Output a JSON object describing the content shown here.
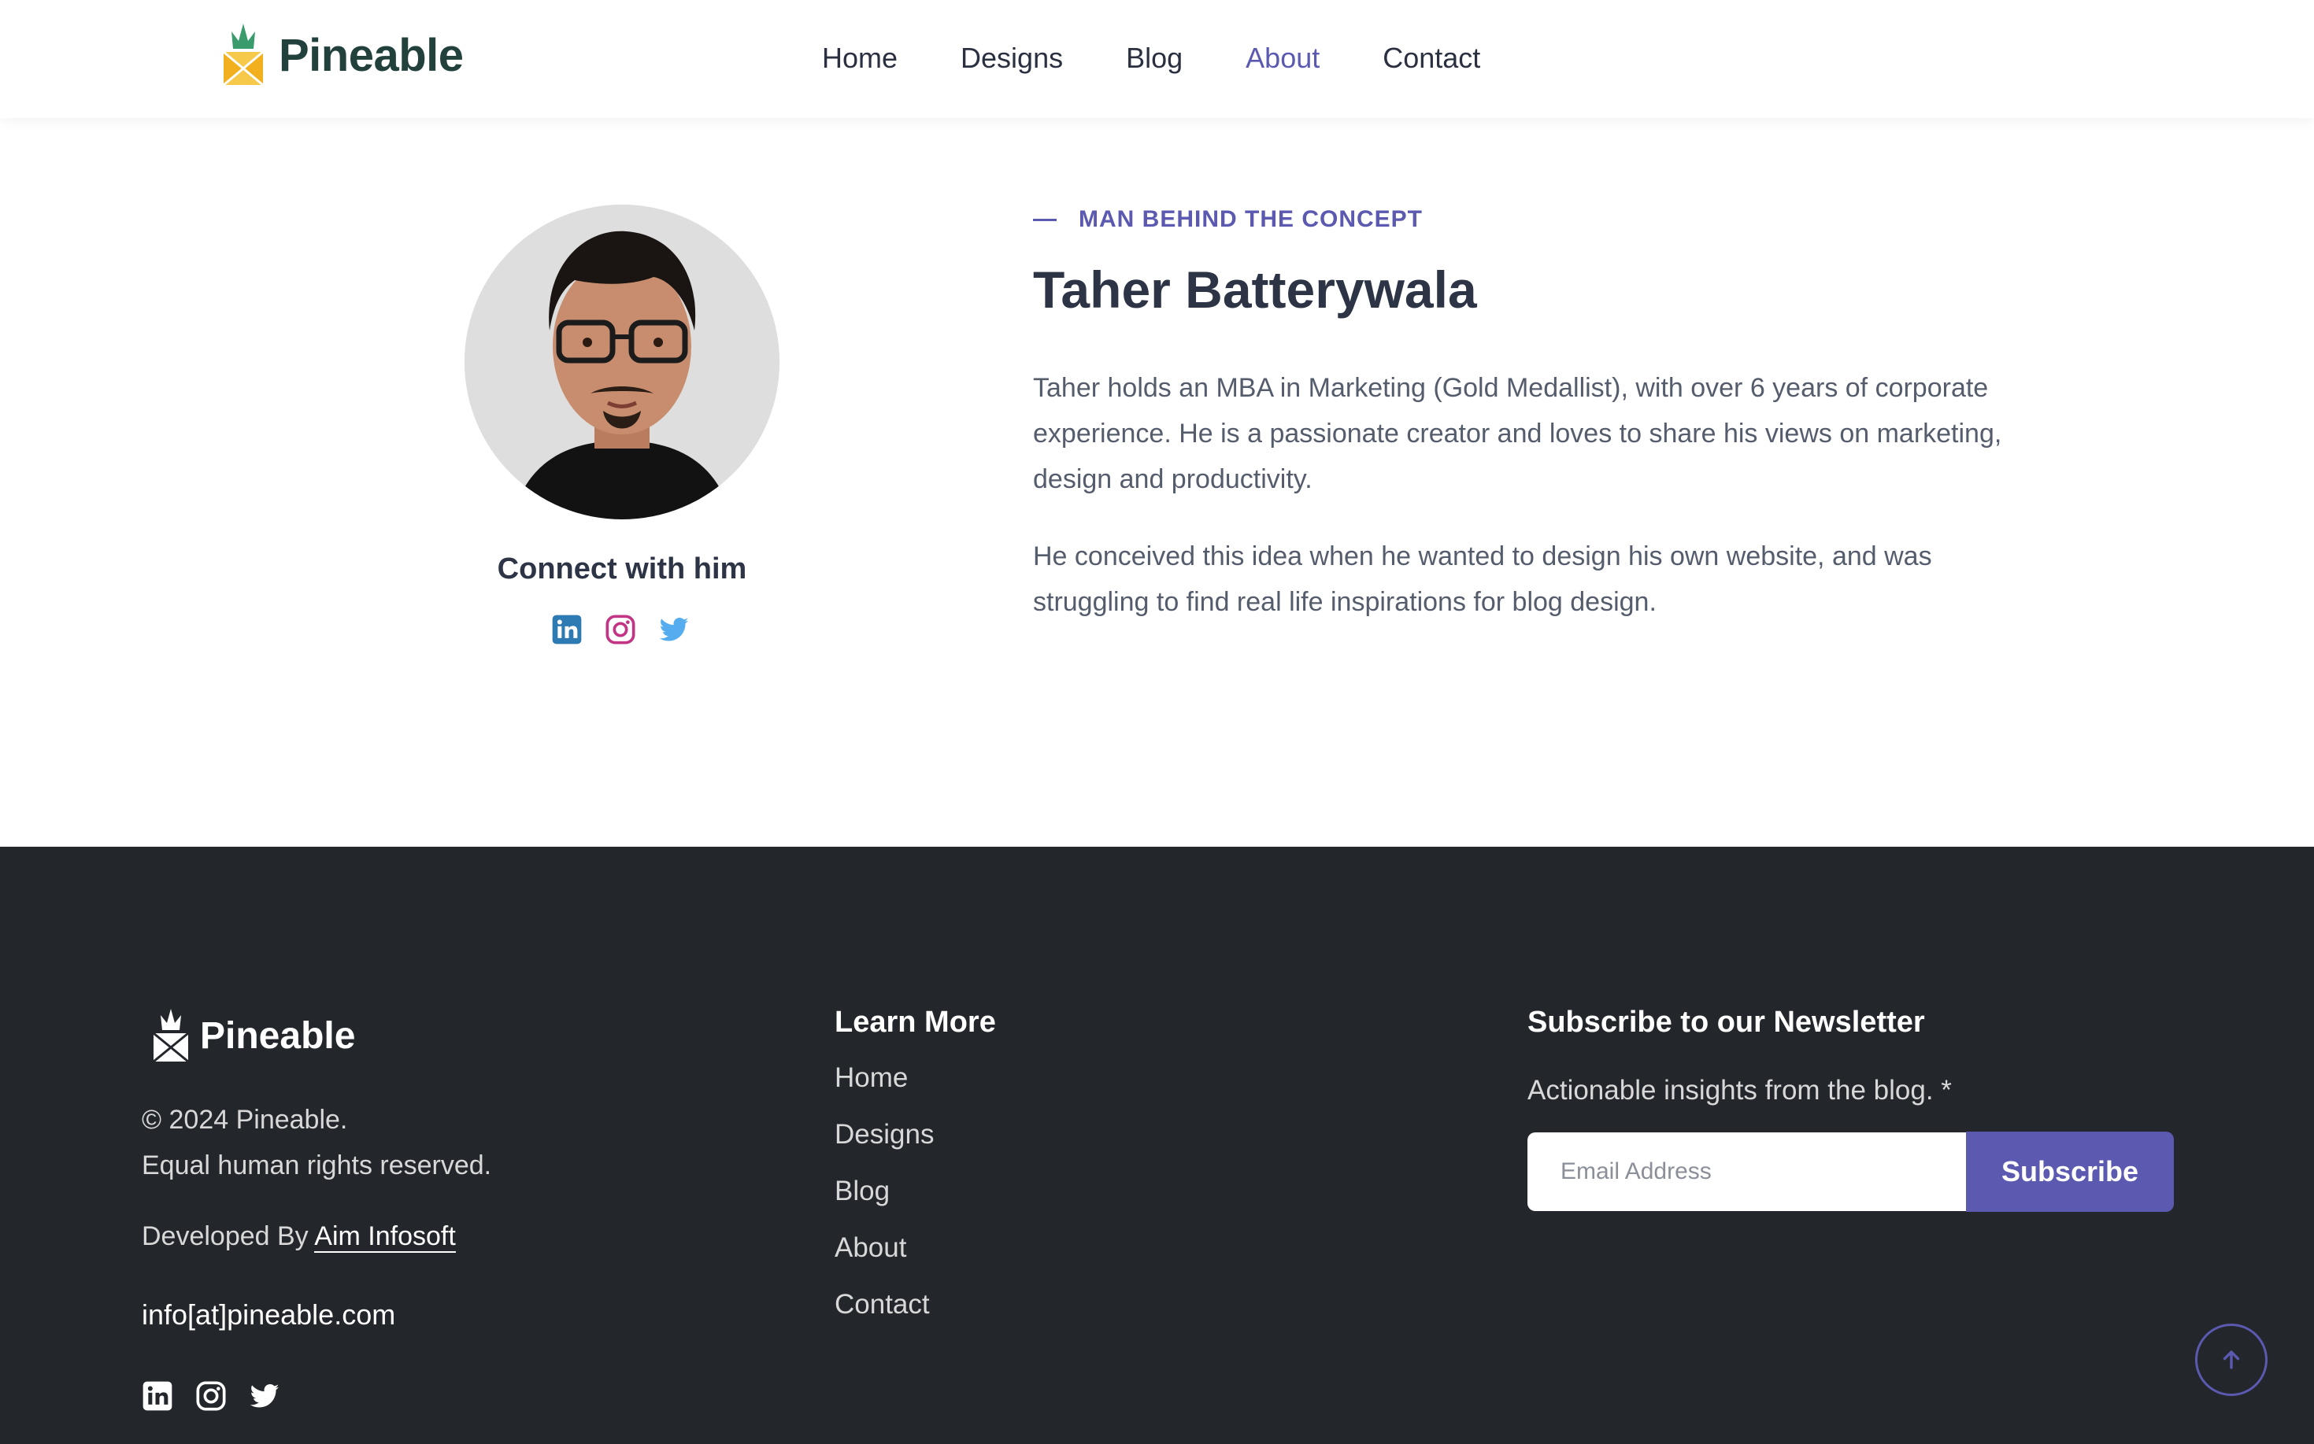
{
  "header": {
    "brand": "Pineable",
    "nav": [
      {
        "label": "Home",
        "active": false
      },
      {
        "label": "Designs",
        "active": false
      },
      {
        "label": "Blog",
        "active": false
      },
      {
        "label": "About",
        "active": true
      },
      {
        "label": "Contact",
        "active": false
      }
    ]
  },
  "about": {
    "connect_title": "Connect with him",
    "eyebrow": "MAN BEHIND THE CONCEPT",
    "name": "Taher Batterywala",
    "bio": [
      "Taher holds an MBA in Marketing (Gold Medallist), with over 6 years of corporate experience. He is a passionate creator and loves to share his views on marketing, design and productivity.",
      "He conceived this idea when he wanted to design his own website, and was struggling to find real life inspirations for blog design."
    ],
    "social_icons": [
      "linkedin-icon",
      "instagram-icon",
      "twitter-icon"
    ]
  },
  "footer": {
    "brand": "Pineable",
    "copyright": "© 2024 Pineable.",
    "rights": "Equal human rights reserved.",
    "developed_by": "Developed By",
    "developer": "Aim Infosoft",
    "email": "info[at]pineable.com",
    "learn_more_title": "Learn More",
    "learn_more_links": [
      "Home",
      "Designs",
      "Blog",
      "About",
      "Contact"
    ],
    "newsletter_title": "Subscribe to our Newsletter",
    "newsletter_subtitle": "Actionable insights from the blog. *",
    "email_placeholder": "Email Address",
    "subscribe_label": "Subscribe"
  },
  "colors": {
    "accent": "#5b59b0",
    "footer_bg": "#23262b",
    "linkedin": "#2e7bb4",
    "instagram": "#c13584",
    "twitter": "#55acee"
  }
}
